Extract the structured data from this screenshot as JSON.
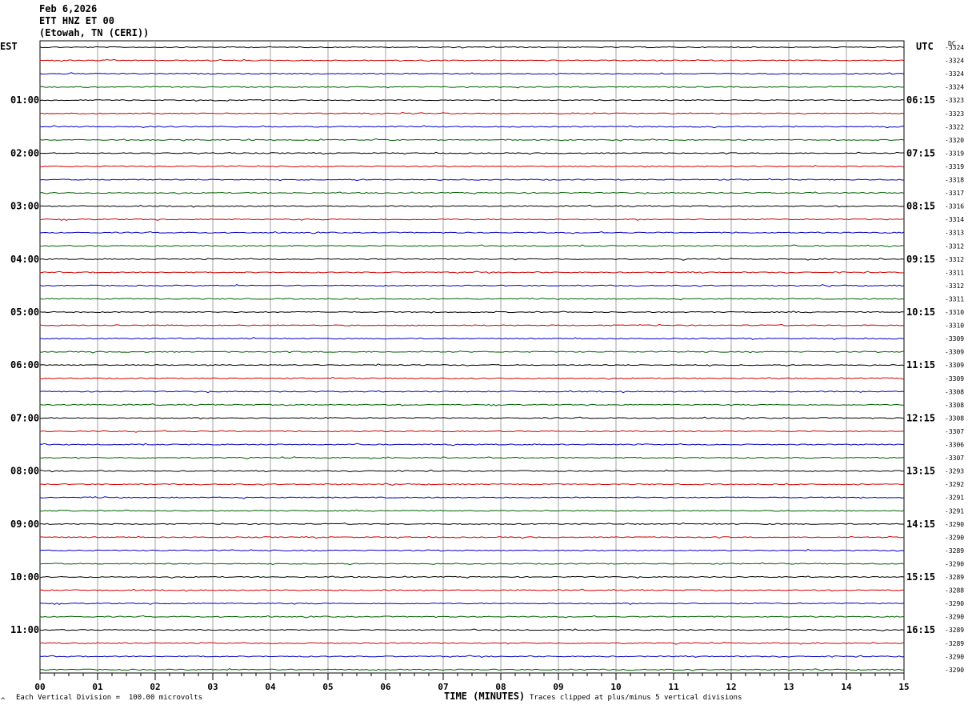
{
  "header": {
    "date": "Feb 6,2026",
    "station": "ETT HNZ ET 00",
    "location": "(Etowah, TN (CERI))"
  },
  "left_tz": "EST",
  "right_tz": "UTC",
  "dc_header": "DC",
  "footer": {
    "mark": "^",
    "scale": "Each Vertical Division =  100.00 microvolts",
    "clip": "Traces clipped at plus/minus 5 vertical divisions"
  },
  "colors": {
    "trace": [
      "#000000",
      "#d00000",
      "#0000c0",
      "#006000"
    ],
    "grid": "#a0a0a0"
  },
  "chart_data": {
    "type": "line",
    "xlabel": "TIME (MINUTES)",
    "xlim": [
      0,
      15
    ],
    "x_ticks": [
      "00",
      "01",
      "02",
      "03",
      "04",
      "05",
      "06",
      "07",
      "08",
      "09",
      "10",
      "11",
      "12",
      "13",
      "14",
      "15"
    ],
    "est_labels": [
      "01:00",
      "02:00",
      "03:00",
      "04:00",
      "05:00",
      "06:00",
      "07:00",
      "08:00",
      "09:00",
      "10:00",
      "11:00"
    ],
    "utc_labels": [
      "06:15",
      "07:15",
      "08:15",
      "09:15",
      "10:15",
      "11:15",
      "12:15",
      "13:15",
      "14:15",
      "15:15",
      "16:15"
    ],
    "dc_offsets": [
      "-3324",
      "-3324",
      "-3324",
      "-3324",
      "-3323",
      "-3323",
      "-3322",
      "-3320",
      "-3319",
      "-3319",
      "-3318",
      "-3317",
      "-3316",
      "-3314",
      "-3313",
      "-3312",
      "-3312",
      "-3311",
      "-3312",
      "-3311",
      "-3310",
      "-3310",
      "-3309",
      "-3309",
      "-3309",
      "-3309",
      "-3308",
      "-3308",
      "-3308",
      "-3307",
      "-3306",
      "-3307",
      "-3293",
      "-3292",
      "-3291",
      "-3291",
      "-3290",
      "-3290",
      "-3289",
      "-3290",
      "-3289",
      "-3288",
      "-3290",
      "-3290",
      "-3289",
      "-3289",
      "-3290",
      "-3290"
    ]
  }
}
